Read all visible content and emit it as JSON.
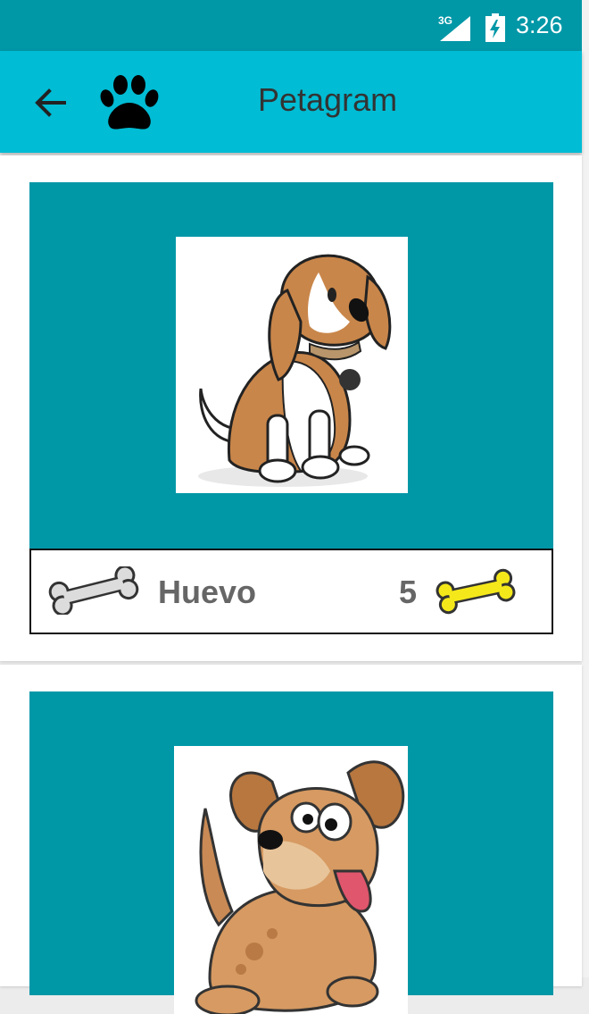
{
  "status_bar": {
    "network": "3G",
    "time": "3:26"
  },
  "app_bar": {
    "title": "Petagram"
  },
  "pets": [
    {
      "name": "Huevo",
      "likes": "5",
      "image": "beagle-illustration"
    },
    {
      "name": "",
      "likes": "",
      "image": "brown-puppy-illustration"
    }
  ],
  "colors": {
    "status_bar": "#0097a7",
    "app_bar": "#00bcd4",
    "card_photo_bg": "#0097a7",
    "rating_bone": "#f5e81a",
    "like_bone": "#dddddd"
  }
}
